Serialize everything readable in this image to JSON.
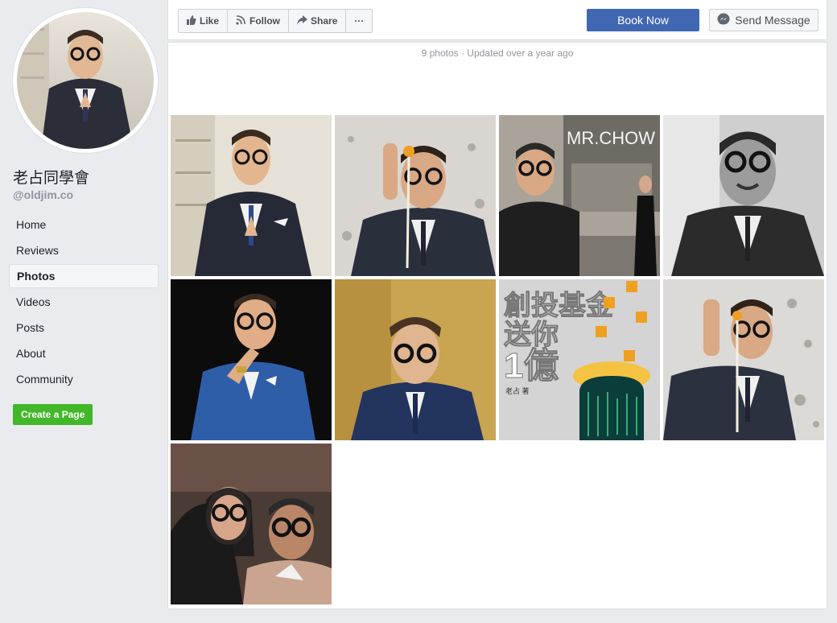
{
  "page": {
    "name": "老占同學會",
    "handle": "@oldjim.co"
  },
  "nav": {
    "items": [
      {
        "label": "Home"
      },
      {
        "label": "Reviews"
      },
      {
        "label": "Photos"
      },
      {
        "label": "Videos"
      },
      {
        "label": "Posts"
      },
      {
        "label": "About"
      },
      {
        "label": "Community"
      }
    ],
    "active": "Photos",
    "create_page_label": "Create a Page"
  },
  "actions": {
    "like_label": "Like",
    "follow_label": "Follow",
    "share_label": "Share",
    "more_label": "···",
    "book_label": "Book Now",
    "message_label": "Send Message"
  },
  "album": {
    "meta": "9 photos · Updated over a year ago",
    "photos": [
      {
        "theme": "suit-in-bar"
      },
      {
        "theme": "egg-crack"
      },
      {
        "theme": "mr-chow-street"
      },
      {
        "theme": "bw-portrait"
      },
      {
        "theme": "blue-suit-black"
      },
      {
        "theme": "gold-backdrop"
      },
      {
        "theme": "book-cover"
      },
      {
        "theme": "egg-crack-2"
      },
      {
        "theme": "couple-selfie"
      }
    ]
  },
  "photo_texts": {
    "mr_chow_sign": "MR.CHOW",
    "book_title_line1": "創投基金",
    "book_title_line2": "送你",
    "book_title_line3": "1億",
    "book_author": "老占 著"
  },
  "colors": {
    "brand_blue": "#4267b2",
    "create_green": "#42b72a",
    "background": "#e9ebee"
  }
}
